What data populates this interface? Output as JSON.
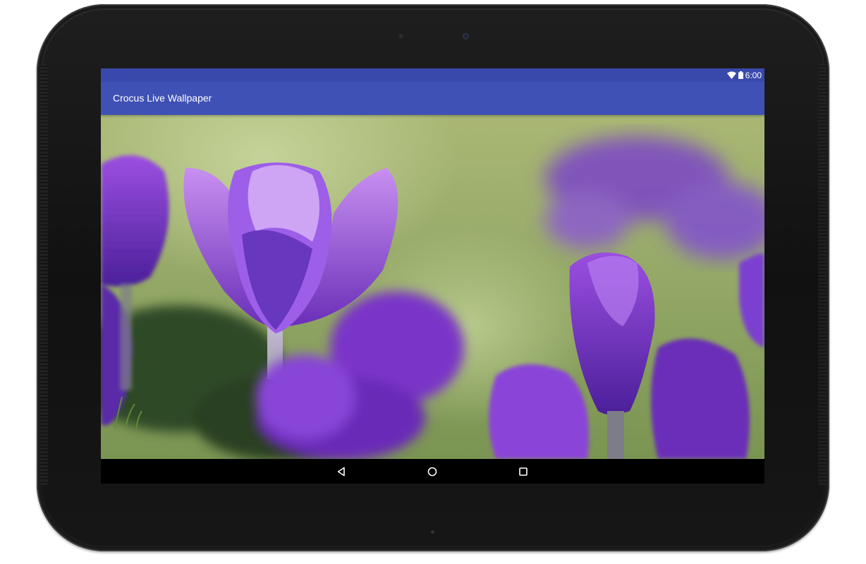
{
  "status_bar": {
    "time": "6:00",
    "icons": [
      "wifi-icon",
      "battery-icon"
    ]
  },
  "app_bar": {
    "title": "Crocus Live Wallpaper"
  },
  "wallpaper": {
    "subject": "purple-crocus-flowers"
  },
  "nav_bar": {
    "buttons": [
      "back-icon",
      "home-icon",
      "recents-icon"
    ]
  },
  "colors": {
    "status_bar": "#3949ab",
    "app_bar": "#3f51b5",
    "nav_bar": "#000000"
  }
}
